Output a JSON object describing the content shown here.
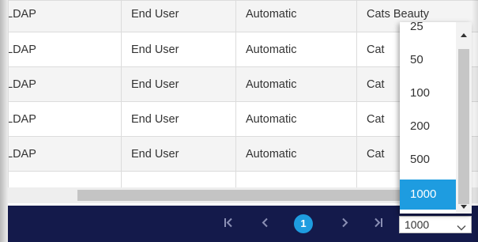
{
  "grid": {
    "rows": [
      [
        "LDAP",
        "End User",
        "Automatic",
        "Cats Beauty"
      ],
      [
        "LDAP",
        "End User",
        "Automatic",
        "Cat"
      ],
      [
        "LDAP",
        "End User",
        "Automatic",
        "Cat"
      ],
      [
        "LDAP",
        "End User",
        "Automatic",
        "Cat"
      ],
      [
        "LDAP",
        "End User",
        "Automatic",
        "Cat"
      ]
    ]
  },
  "pager": {
    "first_icon": "first-page-icon",
    "prev_icon": "chevron-left-icon",
    "current_page": "1",
    "next_icon": "chevron-right-icon",
    "last_icon": "last-page-icon",
    "page_size": "1000"
  },
  "page_size_dropdown": {
    "options": [
      "25",
      "50",
      "100",
      "200",
      "500",
      "1000"
    ],
    "selected": "1000"
  },
  "colors": {
    "pager_background": "#141a4b",
    "accent": "#1e9ce0"
  }
}
